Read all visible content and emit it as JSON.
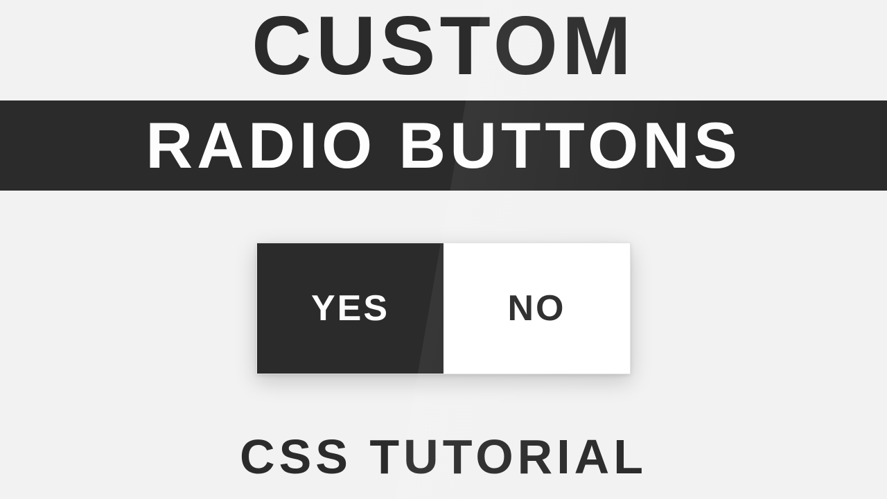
{
  "title": "CUSTOM",
  "banner": "RADIO BUTTONS",
  "radio": {
    "option_yes": "YES",
    "option_no": "NO",
    "selected": "yes"
  },
  "footer": "CSS TUTORIAL",
  "colors": {
    "bg": "#f2f2f2",
    "dark": "#2b2b2b",
    "light": "#ffffff"
  }
}
